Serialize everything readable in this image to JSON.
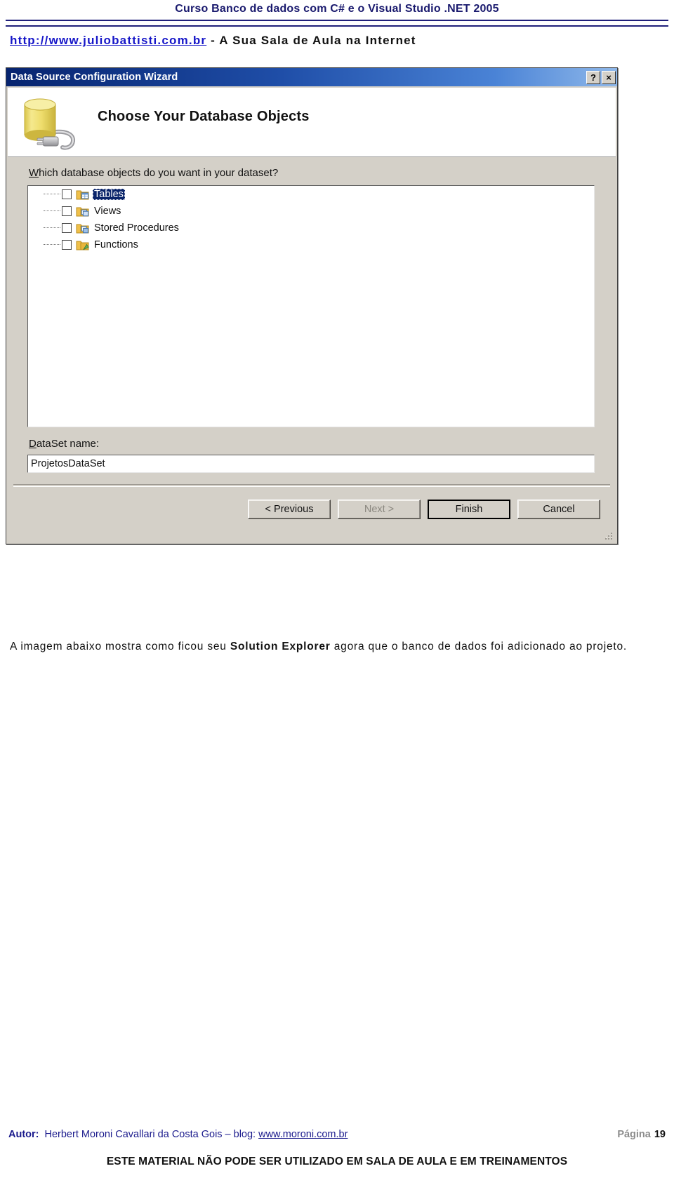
{
  "header": {
    "course_title": "Curso Banco de dados com C# e o Visual Studio .NET 2005",
    "site_url": "http://www.juliobattisti.com.br",
    "site_tagline": " - A Sua Sala de Aula na Internet"
  },
  "dialog": {
    "title": "Data Source Configuration Wizard",
    "help_button": "?",
    "close_button": "×",
    "banner_title": "Choose Your Database Objects",
    "banner_icon": "database-connection-icon",
    "prompt_accesskey": "W",
    "prompt_rest": "hich database objects do you want in your dataset?",
    "tree_items": [
      {
        "label": "Tables",
        "checked": false,
        "selected": true,
        "icon": "folder-tables-icon"
      },
      {
        "label": "Views",
        "checked": false,
        "selected": false,
        "icon": "folder-views-icon"
      },
      {
        "label": "Stored Procedures",
        "checked": false,
        "selected": false,
        "icon": "folder-stored-procedures-icon"
      },
      {
        "label": "Functions",
        "checked": false,
        "selected": false,
        "icon": "folder-functions-icon"
      }
    ],
    "dataset_label_accesskey": "D",
    "dataset_label_rest": "ataSet name:",
    "dataset_value": "ProjetosDataSet",
    "buttons": [
      {
        "label": "< Previous",
        "state": "enabled",
        "name": "previous-button"
      },
      {
        "label": "Next >",
        "state": "disabled",
        "name": "next-button"
      },
      {
        "label": "Finish",
        "state": "default",
        "name": "finish-button"
      },
      {
        "label": "Cancel",
        "state": "enabled",
        "name": "cancel-button"
      }
    ]
  },
  "content": {
    "paragraph_part1": "A imagem abaixo mostra como ficou seu ",
    "paragraph_bold": "Solution Explorer",
    "paragraph_part2": " agora que o banco de dados foi adicionado ao projeto."
  },
  "footer": {
    "autor_label": "Autor:",
    "autor_name": "Herbert Moroni Cavallari da Costa Gois",
    "blog_label": "– blog:",
    "blog_url": "www.moroni.com.br",
    "page_label": "Página",
    "page_number": "19",
    "disclaimer": "ESTE MATERIAL NÃO PODE SER UTILIZADO EM SALA DE AULA E EM TREINAMENTOS"
  },
  "colors": {
    "brand_blue": "#1a1a8c",
    "link_blue": "#1616c8",
    "titlebar_blue": "#07246f",
    "selection_blue": "#0a246a",
    "dialog_face": "#d4d0c8"
  }
}
